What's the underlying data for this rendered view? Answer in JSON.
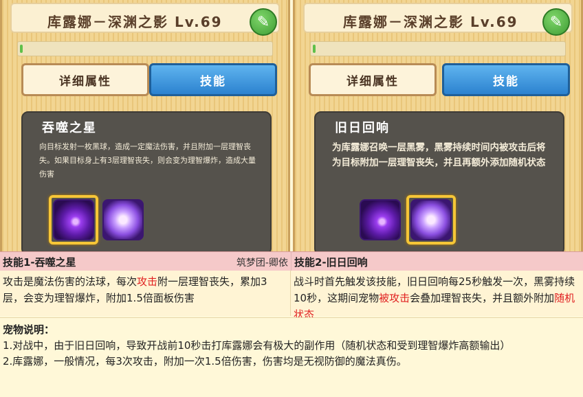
{
  "panels": [
    {
      "title": "库露娜－深渊之影 Lv.69",
      "tab_detail": "详细属性",
      "tab_skills": "技能",
      "skill_name": "吞噬之星",
      "skill_desc": "向目标发射一枚黑球，造成一定魔法伤害，并且附加一层理智丧失。如果目标身上有3层理智丧失，则会变为理智爆炸，造成大量伤害"
    },
    {
      "title": "库露娜－深渊之影 Lv.69",
      "tab_detail": "详细属性",
      "tab_skills": "技能",
      "skill_name": "旧日回响",
      "skill_desc": "为库露娜召唤一层黑雾，黑雾持续时间内被攻击后将为目标附加一层理智丧失，并且再额外添加随机状态"
    }
  ],
  "xp_fill_fraction": 0.01,
  "table": {
    "skill1_heading": "技能1-吞噬之星",
    "credit": "筑梦团-卿依",
    "skill2_heading": "技能2-旧日回响",
    "skill1_text_a": "攻击是魔法伤害的法球，每次",
    "skill1_text_red": "攻击",
    "skill1_text_b": "附一层理智丧失，累加3层，会变为理智爆炸，附加1.5倍面板伤害",
    "skill2_text_a": "战斗时首先触发该技能，旧日回响每25秒触发一次，黑雾持续10秒，这期间宠物",
    "skill2_text_red1": "被攻击",
    "skill2_text_b": "会叠加理智丧失，并且额外附加",
    "skill2_text_red2": "随机状态"
  },
  "notes": {
    "heading": "宠物说明：",
    "line1": "1.对战中，由于旧日回响，导致开战前10秒击打库露娜会有极大的副作用（随机状态和受到理智爆炸高额输出）",
    "line2": "2.库露娜，一般情况，每3次攻击，附加一次1.5倍伤害，伤害均是无视防御的魔法真伤。"
  },
  "icons": [
    "edit-pencil-icon",
    "purple-flame-skill-icon",
    "purple-orb-skill-icon"
  ],
  "colors": {
    "accent_green": "#5fc04a",
    "tab_blue": "#2c82cf",
    "highlight_red": "#e02020",
    "header_pink": "#f5c9c9"
  }
}
